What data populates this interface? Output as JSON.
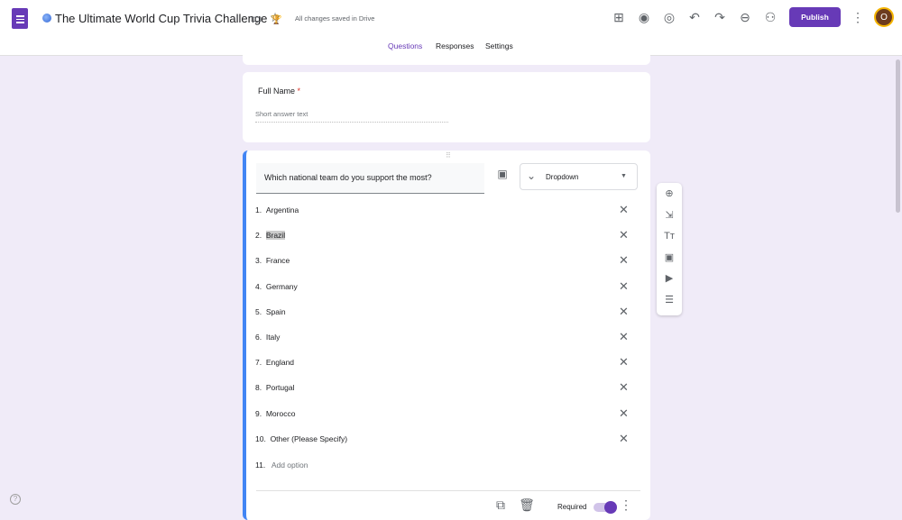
{
  "header": {
    "title": "The Ultimate World Cup Trivia Challenge",
    "title_emoji": "🏆",
    "save_status": "All changes saved in Drive",
    "publish_label": "Publish",
    "avatar_initial": "O"
  },
  "tabs": [
    {
      "label": "Questions"
    },
    {
      "label": "Responses"
    },
    {
      "label": "Settings"
    }
  ],
  "full_name": {
    "label": "Full Name",
    "required_mark": "*",
    "placeholder": "Short answer text"
  },
  "question": {
    "text": "Which national team do you support the most?",
    "type": "Dropdown",
    "options": [
      {
        "n": "1.",
        "label": "Argentina"
      },
      {
        "n": "2.",
        "label": "Brazil"
      },
      {
        "n": "3.",
        "label": "France"
      },
      {
        "n": "4.",
        "label": "Germany"
      },
      {
        "n": "5.",
        "label": "Spain"
      },
      {
        "n": "6.",
        "label": "Italy"
      },
      {
        "n": "7.",
        "label": "England"
      },
      {
        "n": "8.",
        "label": "Portugal"
      },
      {
        "n": "9.",
        "label": "Morocco"
      },
      {
        "n": "10.",
        "label": "Other (Please Specify)"
      }
    ],
    "add_option": {
      "n": "11.",
      "label": "Add option"
    },
    "required_label": "Required"
  },
  "colors": {
    "accent": "#673ab7",
    "active_card": "#4285f4",
    "background": "#f0ebf8"
  }
}
